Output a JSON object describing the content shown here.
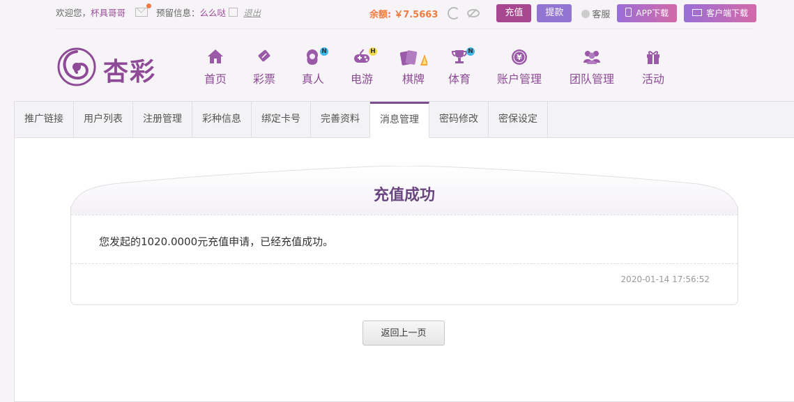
{
  "topbar": {
    "welcome_prefix": "欢迎您，",
    "username": "杯具哥哥",
    "reserved_label": "预留信息：",
    "reserved_value": "么么哒",
    "logout_label": "退出",
    "balance_label": "余额:",
    "balance_value": "￥7.5663",
    "recharge_label": "充值",
    "withdraw_label": "提款",
    "support_label": "客服",
    "app_download_label": "APP下载",
    "client_download_label": "客户端下载"
  },
  "logo": {
    "text": "杏彩"
  },
  "nav": [
    {
      "label": "首页",
      "icon": "home-icon"
    },
    {
      "label": "彩票",
      "icon": "ticket-icon"
    },
    {
      "label": "真人",
      "icon": "dealer-icon",
      "badge": "N"
    },
    {
      "label": "电游",
      "icon": "gamepad-icon",
      "badge": "H"
    },
    {
      "label": "棋牌",
      "icon": "cards-icon"
    },
    {
      "label": "体育",
      "icon": "trophy-icon",
      "badge": "N"
    },
    {
      "label": "账户管理",
      "icon": "yen-icon"
    },
    {
      "label": "团队管理",
      "icon": "team-icon"
    },
    {
      "label": "活动",
      "icon": "gift-icon"
    }
  ],
  "tabs": [
    {
      "label": "推广链接"
    },
    {
      "label": "用户列表"
    },
    {
      "label": "注册管理"
    },
    {
      "label": "彩种信息"
    },
    {
      "label": "绑定卡号"
    },
    {
      "label": "完善资料"
    },
    {
      "label": "消息管理",
      "active": true
    },
    {
      "label": "密码修改"
    },
    {
      "label": "密保设定"
    }
  ],
  "message": {
    "title": "充值成功",
    "body": "您发起的1020.0000元充值申请，已经充值成功。",
    "time": "2020-01-14 17:56:52"
  },
  "back_button_label": "返回上一页",
  "colors": {
    "accent": "#8e4a96",
    "recharge_button": "#a6478f",
    "withdraw_button": "#9274d3",
    "balance": "#f07b3f",
    "badge_new": "#3fb8e8",
    "badge_hot": "#f3d84c"
  }
}
